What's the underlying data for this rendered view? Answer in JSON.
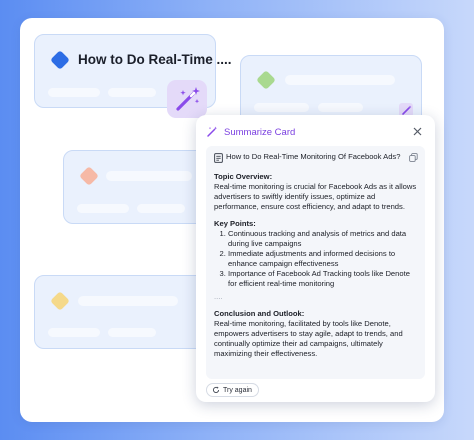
{
  "colors": {
    "accent_purple": "#7a3fe0",
    "card_border": "#c9daf6",
    "card_fill": "#eaf1fd",
    "diamond_blue": "#2d6de5",
    "diamond_green": "#a9d98f",
    "diamond_peach": "#f6b9a6",
    "diamond_yellow": "#f5d98a"
  },
  "background_cards": [
    {
      "title": "How to Do Real-Time ....",
      "icon": "blue-diamond-icon"
    },
    {
      "title": "",
      "icon": "green-diamond-icon"
    },
    {
      "title": "",
      "icon": "peach-diamond-icon"
    },
    {
      "title": "",
      "icon": "yellow-diamond-icon"
    }
  ],
  "summarize": {
    "title": "Summarize Card",
    "icon": "magic-wand-icon",
    "close_icon": "close-icon",
    "question": "How to Do Real-Time Monitoring Of Facebook Ads?",
    "topic_title": "Topic Overview:",
    "topic_text": "Real-time monitoring is crucial for Facebook Ads as it allows advertisers to swiftly identify issues, optimize ad performance, ensure cost efficiency, and adapt to trends.",
    "key_points_title": "Key Points:",
    "key_points": [
      "Continuous tracking and analysis of metrics and data during live campaigns",
      "Immediate adjustments and informed decisions to enhance campaign effectiveness",
      "Importance of Facebook Ad Tracking tools like Denote for efficient real-time monitoring"
    ],
    "ellipsis": "....",
    "conclusion_title": "Conclusion and Outlook:",
    "conclusion_text": "Real-time monitoring, facilitated by tools like Denote, empowers advertisers to stay agile, adapt to trends, and continually optimize their ad campaigns, ultimately maximizing their effectiveness.",
    "try_again_label": "Try again"
  }
}
